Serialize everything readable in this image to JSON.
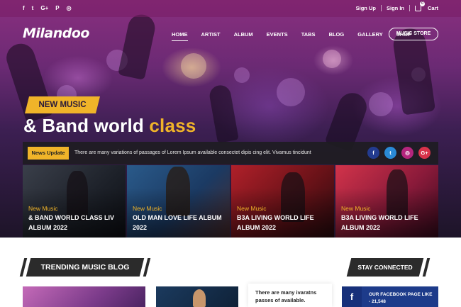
{
  "topbar": {
    "social_icons": [
      "f",
      "t",
      "G+",
      "P",
      "◎"
    ],
    "sign_up": "Sign Up",
    "sign_in": "Sign In",
    "cart_label": "Cart",
    "cart_count": "0"
  },
  "brand": {
    "logo": "Milandoo"
  },
  "nav": {
    "items": [
      "HOME",
      "ARTIST",
      "ALBUM",
      "EVENTS",
      "TABS",
      "BLOG",
      "GALLERY",
      "SHOP"
    ],
    "active": "HOME",
    "cta": "MUSIC STORE"
  },
  "hero": {
    "tag": "NEW MUSIC",
    "headline_main": "& Band world",
    "headline_accent": "class"
  },
  "news": {
    "label": "News Update",
    "text": "There are many variations of passages of Lorem Ipsum available consectet dipis cing elit. Vivamus tincidunt",
    "social": [
      "f",
      "t",
      "◎",
      "G+"
    ]
  },
  "cards": [
    {
      "kicker": "New Music",
      "title": "& BAND WORLD CLASS LIV ALBUM 2022"
    },
    {
      "kicker": "New Music",
      "title": "OLD MAN LOVE LIFE ALBUM 2022"
    },
    {
      "kicker": "New Music",
      "title": "B3A LIVING WORLD LIFE ALBUM 2022"
    },
    {
      "kicker": "New Music",
      "title": "B3A LIVING WORLD LIFE ALBUM 2022"
    }
  ],
  "sections": {
    "trending": "TRENDING MUSIC BLOG",
    "stay_connected": "STAY CONNECTED",
    "blog_excerpt": "There are many ivaratns passes of available.",
    "facebook": {
      "icon": "f",
      "text": "OUR FACEBOOK PAGE LIKE - 21,548"
    }
  },
  "colors": {
    "accent": "#f0b429",
    "dark": "#2b2b2b",
    "facebook": "#3b5998",
    "twitter": "#1da1f2",
    "instagram": "#c13584",
    "google": "#db4437"
  }
}
